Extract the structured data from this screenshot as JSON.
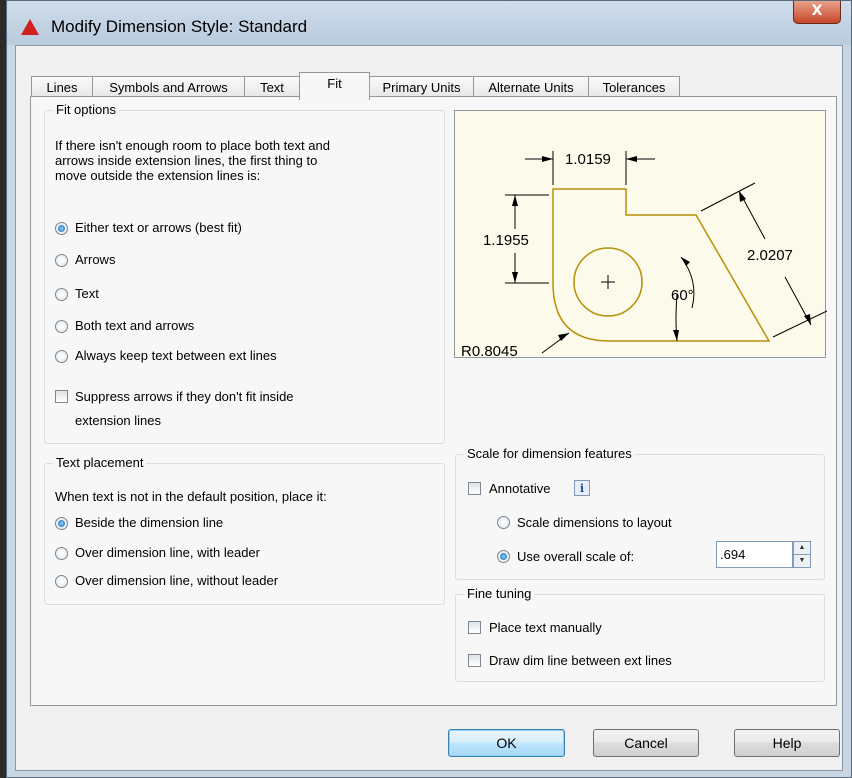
{
  "window": {
    "title": "Modify Dimension Style: Standard",
    "close_label": "X"
  },
  "tabs": [
    {
      "label": "Lines"
    },
    {
      "label": "Symbols and Arrows"
    },
    {
      "label": "Text"
    },
    {
      "label": "Fit",
      "active": true
    },
    {
      "label": "Primary Units"
    },
    {
      "label": "Alternate Units"
    },
    {
      "label": "Tolerances"
    }
  ],
  "fit_options": {
    "title": "Fit options",
    "description": [
      "If there isn't enough room to place both text and",
      "arrows inside extension lines, the first thing to",
      "move outside the extension lines is:"
    ],
    "options": [
      {
        "label": "Either text or arrows (best fit)",
        "selected": true
      },
      {
        "label": "Arrows",
        "selected": false
      },
      {
        "label": "Text",
        "selected": false
      },
      {
        "label": "Both text and arrows",
        "selected": false
      },
      {
        "label": "Always keep text between ext lines",
        "selected": false
      }
    ],
    "suppress_label_line1": "Suppress arrows if they don't fit inside",
    "suppress_label_line2": "extension lines",
    "suppress_checked": false
  },
  "text_placement": {
    "title": "Text placement",
    "description": "When text is not in the default position, place it:",
    "options": [
      {
        "label": "Beside the dimension line",
        "selected": true
      },
      {
        "label": "Over dimension line, with leader",
        "selected": false
      },
      {
        "label": "Over dimension line, without leader",
        "selected": false
      }
    ]
  },
  "preview": {
    "dim_top": "1.0159",
    "dim_left": "1.1955",
    "dim_right": "2.0207",
    "dim_angle": "60°",
    "dim_radius": "R0.8045"
  },
  "scale": {
    "title": "Scale for dimension features",
    "annotative_label": "Annotative",
    "annotative_checked": false,
    "info_glyph": "i",
    "layout_label": "Scale dimensions to layout",
    "layout_selected": false,
    "overall_label": "Use overall scale of:",
    "overall_selected": true,
    "overall_value": ".694"
  },
  "fine_tuning": {
    "title": "Fine tuning",
    "place_manually_label": "Place text manually",
    "place_manually_checked": false,
    "draw_dim_line_label": "Draw dim line between ext lines",
    "draw_dim_line_checked": false
  },
  "buttons": {
    "ok": "OK",
    "cancel": "Cancel",
    "help": "Help"
  },
  "colors": {
    "preview_geometry": "#b8900a",
    "preview_background": "#fcfaeb",
    "close_button": "#c7462a"
  }
}
